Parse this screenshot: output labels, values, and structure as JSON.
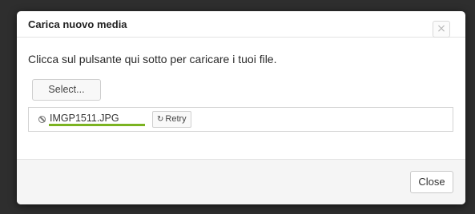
{
  "modal": {
    "title": "Carica nuovo media",
    "close_icon": "close-icon",
    "close_glyph": "×"
  },
  "body": {
    "instructions": "Clicca sul pulsante qui sotto per caricare i tuoi file.",
    "select_label": "Select..."
  },
  "upload": {
    "file_name": "IMGP1511.JPG",
    "progress_percent": 100,
    "progress_color": "#7bb321",
    "status_icon": "cancel-icon",
    "retry_icon": "refresh-icon",
    "retry_glyph": "↻",
    "retry_label": "Retry"
  },
  "footer": {
    "close_label": "Close"
  }
}
